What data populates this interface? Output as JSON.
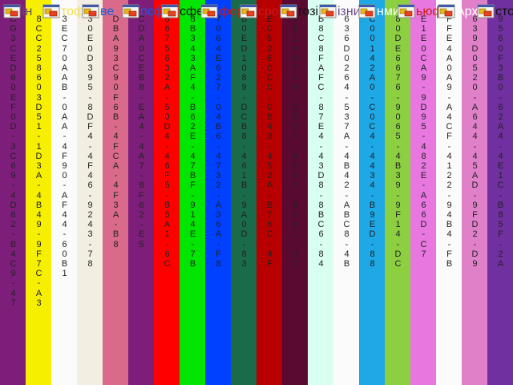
{
  "toolbar": {
    "items": [
      {
        "icon": "app-window-icon",
        "label": "Ін",
        "color": "#5a4a6a"
      },
      {
        "icon": "app-window-icon",
        "label": "тоф",
        "color": "#f0e050"
      },
      {
        "icon": "app-window-icon",
        "label": "ве",
        "color": "#1d5bd8"
      },
      {
        "icon": "app-window-icon",
        "label": "псф",
        "color": "#1d5bd8"
      },
      {
        "icon": "app-window-icon",
        "label": "сфе",
        "color": "#111111"
      },
      {
        "icon": "app-window-icon",
        "label": "фор",
        "color": "#c81a1a"
      },
      {
        "icon": "app-window-icon",
        "label": "сро",
        "color": "#c81a1a"
      },
      {
        "icon": "app-window-icon",
        "label": "гозі",
        "color": "#111111"
      },
      {
        "icon": "app-window-icon",
        "label": "ізни",
        "color": "#6a4a8a"
      },
      {
        "icon": "app-window-icon",
        "label": "нми",
        "color": "#ffffff"
      },
      {
        "icon": "app-window-icon",
        "label": "ьюф",
        "color": "#c81a1a"
      },
      {
        "icon": "app-window-icon",
        "label": "Архі",
        "color": "#ffffff"
      },
      {
        "icon": "app-window-icon",
        "label": "сторі",
        "color": "#111111"
      }
    ]
  },
  "strips": [
    {
      "color": "#7d1f7a",
      "text": "C\nG\n3\nC\nE\nD\n6\n0\nE\nF\n0\nD\n-\n3\nC\n6\n9\n-\n4\nD\n8\n2\n-\nB\n4\nC\n9\n-\n4\n7"
    },
    {
      "color": "#f6ef00",
      "text": "8\nC\nC\n2\n5\n8\n6\n0\n3\nD\n5\n1\n-\n1\nD\n3\nA\n-\n4\nB\n4\n9\n-\n9\nF\n7\nC\n-\nA\n3"
    },
    {
      "color": "#fbfbfb",
      "text": "3\nE\nC\n7\n0\nA\nA\nB\n-\n0\nA\nA\n-\n4\nF\n9\n0\n-\nA\nF\n4\n4\n-\n6\n0\nB\n1"
    },
    {
      "color": "#f2efe2",
      "text": "3\n0\nE\n0\nD\n3\n9\n5\n-\n8\nD\nF\n4\n-\n4\nF\n4\n6\n-\n9\n2\n4\n3\n-\n7\n8"
    },
    {
      "color": "#d96a8a",
      "text": "D\nB\nA\n9\n3\nC\n9\n0\nF\n6\nB\n-\n4\nF\nC\nA\n-\n4\nF\n3\nA\n-\nB\n8"
    },
    {
      "color": "#7d1f7a",
      "text": "C\nD\nA\n0\nC\nE\nB\n8\n-\nE\nA\n4\n-\n4\nA\n7\n-\n8\nF\n6\n2\n-\nE\n5"
    },
    {
      "color": "#ff0000",
      "text": "8\n6\n7\n5\n6\n3\n2\nA\n-\n5\n0\nD\n4\n-\n4\n6\nF\n5\n-\nB\n5\nA\n1\n-\n6\nC"
    },
    {
      "color": "#00e600",
      "text": "8\nB\n3\n4\n3\nA\nF\n4\n-\nB\n6\n2\nE\n-\n4\n7\nB\nF\n-\n9\n1\n4\nE\n-\n7\nB"
    },
    {
      "color": "#0040ff",
      "text": "7\n0\n6\n4\nE\n6\n2\n7\n-\n0\n4\nB\n6\n-\n4\n7\n3\n2\n-\nA\n3\n6\nA\n-\nF\n8"
    },
    {
      "color": "#1a6b4a",
      "text": "B\n0\nE\nD\n1\n0\n8\n9\n-\nD\nC\nB\n8\n-\n4\n6\n1\nB\n-\n9\nA\n0\nD\n-\n8\n3"
    },
    {
      "color": "#b80000",
      "text": "E\n0\n5\n2\n6\n0\nC\n0\n-\n0\n8\n4\n3\n-\n4\n5\n2\nA\n-\nB\n7\n6\nC\n-\n4\nF"
    },
    {
      "color": "#5a0a30",
      "text": "3\n6\n1\nA\n8\n7\nC\n4\n-\nD\n5\n2\nF\n-\n4\nE\n9\n0\n-\n8\n6\nB\n1\n-\n3\nD"
    },
    {
      "color": "#d8fff0",
      "text": "B\n8\nC\n8\nF\nA\nF\nC\n-\n8\n7\nE\n4\n-\n4\n3\nD\n8\n-\n8\nB\nC\n6\n-\n8\n4"
    },
    {
      "color": "#fbfbfb",
      "text": "6\n3\n6\nD\n0\n2\n6\n4\n-\n5\n3\n7\nA\n-\n4\nB\n4\n2\n-\nA\nB\nC\n8\n-\n4\nB"
    },
    {
      "color": "#1ea8e6",
      "text": "C\n0\n0\n1\n4\n2\nA\n0\n-\nC\n0\nC\n4\n-\n4\n4\n3\n4\n-\nB\n9\nE\nD\n-\n8\n8"
    },
    {
      "color": "#8ccf40",
      "text": "8\n0\nD\nE\n6\n6\n7\n6\n-\n9\n0\n6\n5\n-\n4\nB\n3\n9\n-\n9\nF\n1\n4\n-\nD\nC"
    },
    {
      "color": "#e878e0",
      "text": "E\n1\nE\n0\nC\nA\n9\n-\n9\nD\n9\n5\n-\n4\n8\n2\nE\n-\nA\n6\n6\nD\n-\nC\n7"
    },
    {
      "color": "#fbfbfb",
      "text": "F\nF\nE\n4\nA\n0\nA\n9\n-\nA\n4\nC\nF\n-\n4\n1\n2\n2\n-\n9\n4\nB\n4\n-\nF\nB"
    },
    {
      "color": "#e080c8",
      "text": "6\n3\n9\nD\n0\n5\n2\n0\n-\nA\n6\n4\n4\n-\n4\n5\nA\nD\n-\n9\nF\nD\n2\n-\nD\n9"
    },
    {
      "color": "#7030a0",
      "text": "9\n5\n6\n0\nF\n3\nB\n0\n-\n6\n2\nA\n4\n-\n4\nE\n1\nC\n-\nB\n8\n5\nF\n-\n2\nA"
    }
  ]
}
